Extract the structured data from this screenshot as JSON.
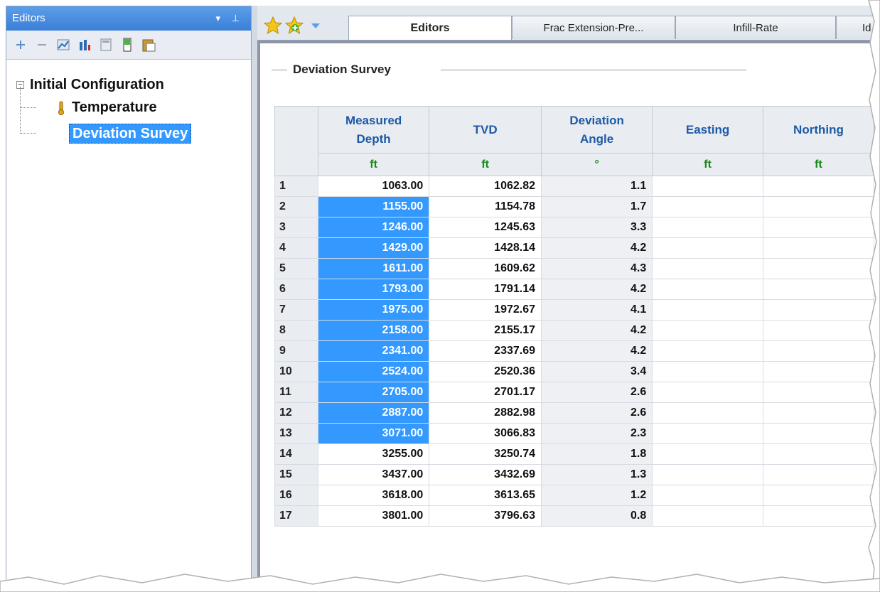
{
  "left_panel": {
    "title": "Editors",
    "pin_controls": "▾ ⊥",
    "toolbar_icons": [
      "plus-icon",
      "minus-icon",
      "chart-icon",
      "bar-chart-icon",
      "calculator-icon",
      "battery-icon",
      "paste-icon"
    ],
    "tree": {
      "root": "Initial Configuration",
      "expander": "−",
      "children": [
        "Temperature",
        "Deviation Survey"
      ]
    }
  },
  "tabs": [
    "Editors",
    "Frac Extension-Pre...",
    "Infill-Rate",
    "Id"
  ],
  "section_title": "Deviation Survey",
  "table": {
    "headers": [
      {
        "l1": "Measured",
        "l2": "Depth"
      },
      {
        "l1": "TVD",
        "l2": ""
      },
      {
        "l1": "Deviation",
        "l2": "Angle"
      },
      {
        "l1": "Easting",
        "l2": ""
      },
      {
        "l1": "Northing",
        "l2": ""
      }
    ],
    "units": [
      "ft",
      "ft",
      "°",
      "ft",
      "ft"
    ],
    "rows": [
      {
        "n": "1",
        "md": "1063.00",
        "tvd": "1062.82",
        "dev": "1.1"
      },
      {
        "n": "2",
        "md": "1155.00",
        "tvd": "1154.78",
        "dev": "1.7"
      },
      {
        "n": "3",
        "md": "1246.00",
        "tvd": "1245.63",
        "dev": "3.3"
      },
      {
        "n": "4",
        "md": "1429.00",
        "tvd": "1428.14",
        "dev": "4.2"
      },
      {
        "n": "5",
        "md": "1611.00",
        "tvd": "1609.62",
        "dev": "4.3"
      },
      {
        "n": "6",
        "md": "1793.00",
        "tvd": "1791.14",
        "dev": "4.2"
      },
      {
        "n": "7",
        "md": "1975.00",
        "tvd": "1972.67",
        "dev": "4.1"
      },
      {
        "n": "8",
        "md": "2158.00",
        "tvd": "2155.17",
        "dev": "4.2"
      },
      {
        "n": "9",
        "md": "2341.00",
        "tvd": "2337.69",
        "dev": "4.2"
      },
      {
        "n": "10",
        "md": "2524.00",
        "tvd": "2520.36",
        "dev": "3.4"
      },
      {
        "n": "11",
        "md": "2705.00",
        "tvd": "2701.17",
        "dev": "2.6"
      },
      {
        "n": "12",
        "md": "2887.00",
        "tvd": "2882.98",
        "dev": "2.6"
      },
      {
        "n": "13",
        "md": "3071.00",
        "tvd": "3066.83",
        "dev": "2.3"
      },
      {
        "n": "14",
        "md": "3255.00",
        "tvd": "3250.74",
        "dev": "1.8"
      },
      {
        "n": "15",
        "md": "3437.00",
        "tvd": "3432.69",
        "dev": "1.3"
      },
      {
        "n": "16",
        "md": "3618.00",
        "tvd": "3613.65",
        "dev": "1.2"
      },
      {
        "n": "17",
        "md": "3801.00",
        "tvd": "3796.63",
        "dev": "0.8"
      }
    ],
    "selected_rows": [
      2,
      3,
      4,
      5,
      6,
      7,
      8,
      9,
      10,
      11,
      12,
      13
    ]
  },
  "colors": {
    "selection": "#3399ff",
    "title_bar": "#3b7fd8",
    "header_text": "#1d5aa6",
    "unit_text": "#1a8a1a"
  }
}
